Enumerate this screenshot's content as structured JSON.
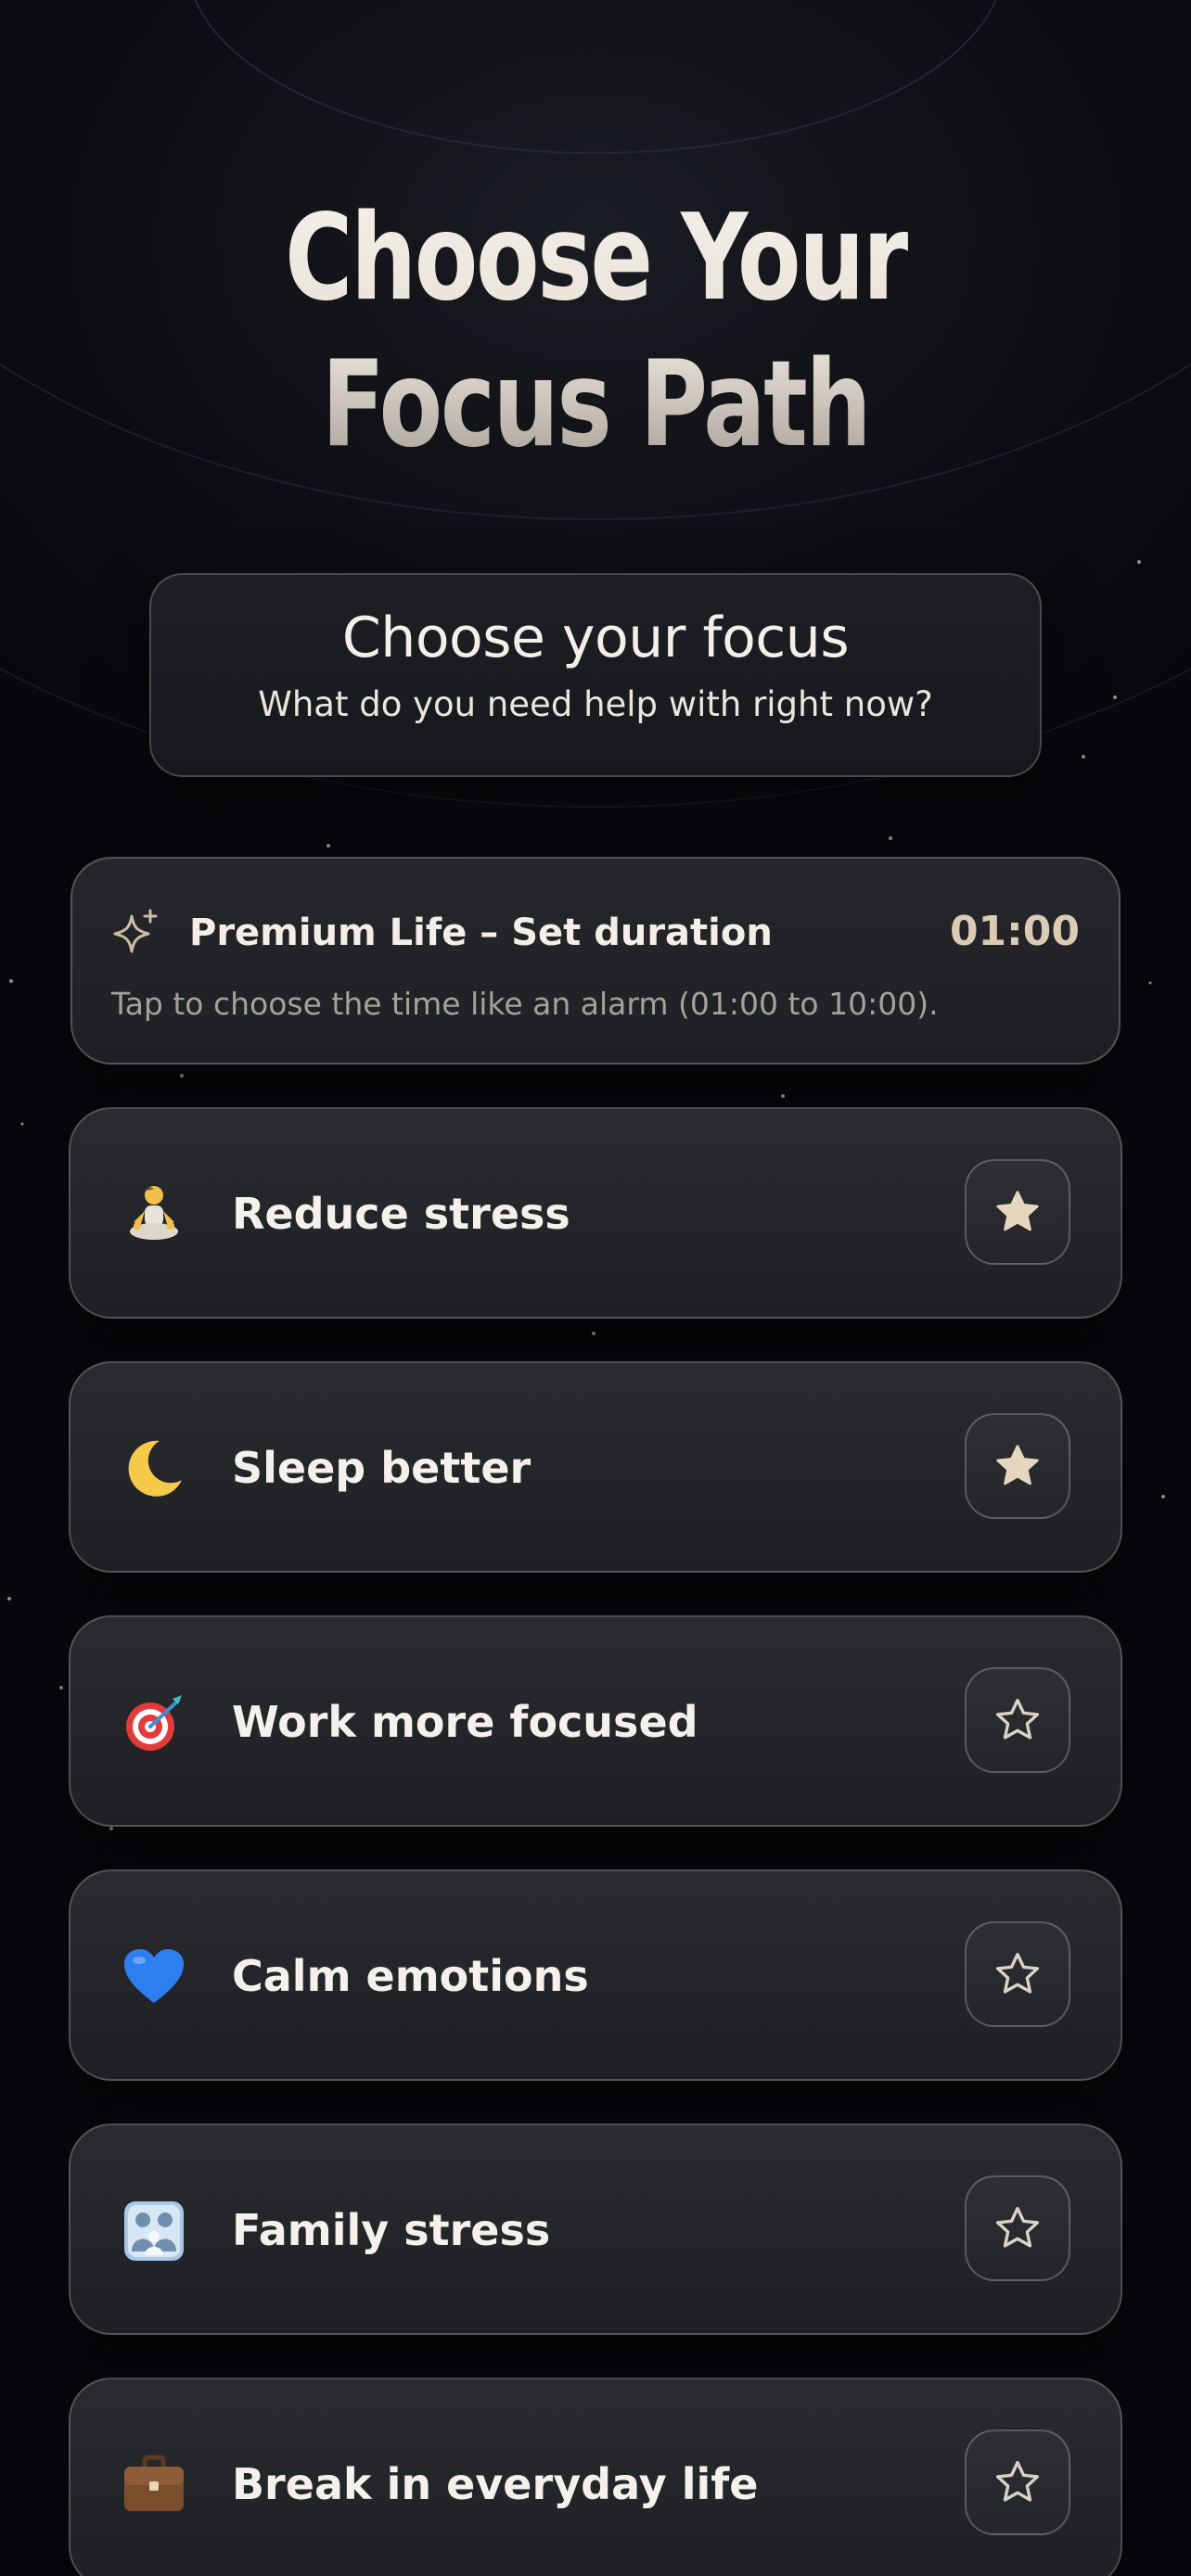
{
  "title_lines": [
    "Choose Your",
    "Focus Path"
  ],
  "focus_card": {
    "heading": "Choose your focus",
    "subheading": "What do you need help with right now?"
  },
  "premium": {
    "icon": "sparkles-icon",
    "title": "Premium Life – Set duration",
    "time": "01:00",
    "description": "Tap to choose the time like an alarm (01:00 to 10:00)."
  },
  "options": [
    {
      "icon": "meditation-icon",
      "label": "Reduce stress",
      "favorite": true
    },
    {
      "icon": "crescent-moon-icon",
      "label": "Sleep better",
      "favorite": true
    },
    {
      "icon": "target-icon",
      "label": "Work more focused",
      "favorite": false
    },
    {
      "icon": "blue-heart-icon",
      "label": "Calm emotions",
      "favorite": false
    },
    {
      "icon": "family-icon",
      "label": "Family stress",
      "favorite": false
    },
    {
      "icon": "briefcase-icon",
      "label": "Break in everyday life",
      "favorite": false
    }
  ],
  "colors": {
    "background": "#08090d",
    "card": "#242529",
    "accent_gold": "#dccbb4",
    "text": "#f4f1ec",
    "muted_text": "#a5a19b"
  }
}
